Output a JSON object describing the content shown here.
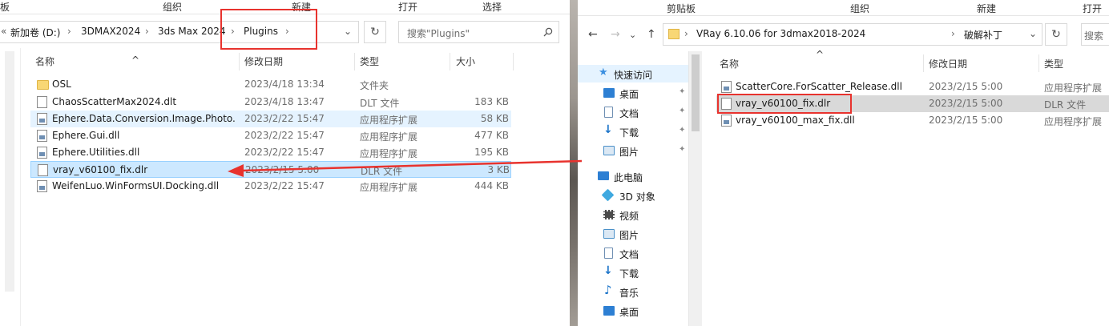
{
  "left_window": {
    "ribbon_groups": [
      "板",
      "组织",
      "新建",
      "打开",
      "选择"
    ],
    "breadcrumb_overflow": "«",
    "breadcrumb": [
      "新加卷 (D:)",
      "3DMAX2024",
      "3ds Max 2024",
      "Plugins"
    ],
    "search_placeholder": "搜索\"Plugins\"",
    "columns": {
      "name": "名称",
      "date": "修改日期",
      "type": "类型",
      "size": "大小"
    },
    "files": [
      {
        "name": "OSL",
        "date": "2023/4/18 13:34",
        "type": "文件夹",
        "size": "",
        "icon": "folder-icon"
      },
      {
        "name": "ChaosScatterMax2024.dlt",
        "date": "2023/4/18 13:47",
        "type": "DLT 文件",
        "size": "183 KB",
        "icon": "file-icon"
      },
      {
        "name": "Ephere.Data.Conversion.Image.Photo...",
        "date": "2023/2/22 15:47",
        "type": "应用程序扩展",
        "size": "58 KB",
        "icon": "dll-icon"
      },
      {
        "name": "Ephere.Gui.dll",
        "date": "2023/2/22 15:47",
        "type": "应用程序扩展",
        "size": "477 KB",
        "icon": "dll-icon"
      },
      {
        "name": "Ephere.Utilities.dll",
        "date": "2023/2/22 15:47",
        "type": "应用程序扩展",
        "size": "195 KB",
        "icon": "dll-icon"
      },
      {
        "name": "vray_v60100_fix.dlr",
        "date": "2023/2/15 5:00",
        "type": "DLR 文件",
        "size": "3 KB",
        "icon": "file-icon"
      },
      {
        "name": "WeifenLuo.WinFormsUI.Docking.dll",
        "date": "2023/2/22 15:47",
        "type": "应用程序扩展",
        "size": "444 KB",
        "icon": "dll-icon"
      }
    ]
  },
  "right_window": {
    "ribbon_groups": [
      "剪贴板",
      "组织",
      "新建",
      "打开"
    ],
    "breadcrumb": [
      "VRay 6.10.06 for 3dmax2018-2024",
      "破解补丁"
    ],
    "search_placeholder": "搜索",
    "nav_tree": [
      {
        "label": "快速访问",
        "icon": "star-icon",
        "color": "#3b8fe0",
        "pinned": false
      },
      {
        "label": "桌面",
        "icon": "desktop-icon",
        "color": "#2d7fd3",
        "pinned": true
      },
      {
        "label": "文档",
        "icon": "document-icon",
        "color": "#6f8fb3",
        "pinned": true
      },
      {
        "label": "下载",
        "icon": "download-icon",
        "color": "#1a73c8",
        "pinned": true
      },
      {
        "label": "图片",
        "icon": "picture-icon",
        "color": "#4a90c8",
        "pinned": true
      },
      {
        "label": "此电脑",
        "icon": "computer-icon",
        "color": "#2d7fd3",
        "pinned": false
      },
      {
        "label": "3D 对象",
        "icon": "3d-objects-icon",
        "color": "#3fa9e0",
        "pinned": false
      },
      {
        "label": "视频",
        "icon": "video-icon",
        "color": "#4a4a4a",
        "pinned": false
      },
      {
        "label": "图片",
        "icon": "picture-icon",
        "color": "#4a90c8",
        "pinned": false
      },
      {
        "label": "文档",
        "icon": "document-icon",
        "color": "#6f8fb3",
        "pinned": false
      },
      {
        "label": "下载",
        "icon": "download-icon",
        "color": "#1a73c8",
        "pinned": false
      },
      {
        "label": "音乐",
        "icon": "music-icon",
        "color": "#1a73c8",
        "pinned": false
      },
      {
        "label": "桌面",
        "icon": "desktop-icon",
        "color": "#2d7fd3",
        "pinned": false
      }
    ],
    "columns": {
      "name": "名称",
      "date": "修改日期",
      "type": "类型"
    },
    "files": [
      {
        "name": "ScatterCore.ForScatter_Release.dll",
        "date": "2023/2/15 5:00",
        "type": "应用程序扩展"
      },
      {
        "name": "vray_v60100_fix.dlr",
        "date": "2023/2/15 5:00",
        "type": "DLR 文件"
      },
      {
        "name": "vray_v60100_max_fix.dll",
        "date": "2023/2/15 5:00",
        "type": "应用程序扩展"
      }
    ]
  },
  "annotations": {
    "highlight_color": "#e8332e",
    "arrow_color": "#e8332e"
  }
}
